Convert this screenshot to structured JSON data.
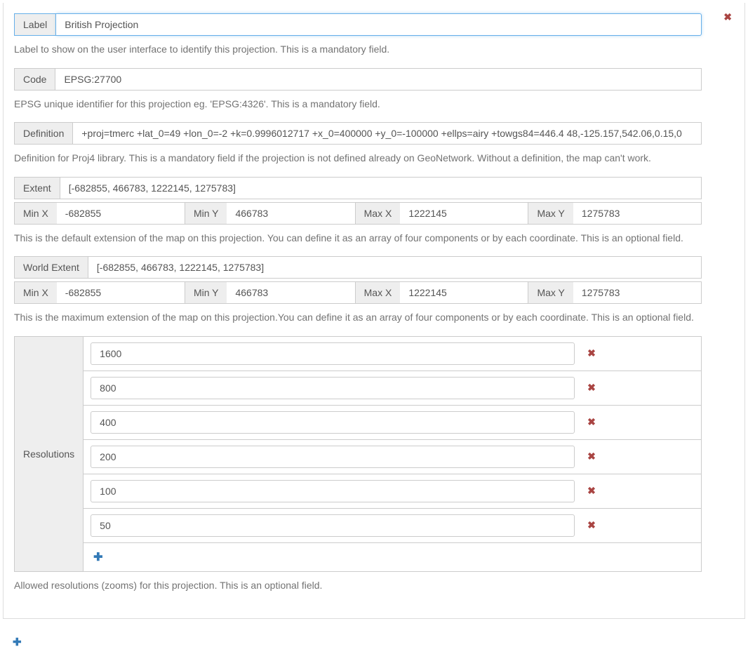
{
  "labels": {
    "label": "Label",
    "code": "Code",
    "definition": "Definition",
    "extent": "Extent",
    "worldExtent": "World Extent",
    "minX": "Min X",
    "minY": "Min Y",
    "maxX": "Max X",
    "maxY": "Max Y",
    "resolutions": "Resolutions"
  },
  "help": {
    "label": "Label to show on the user interface to identify this projection. This is a mandatory field.",
    "code": "EPSG unique identifier for this projection eg. 'EPSG:4326'. This is a mandatory field.",
    "definition": "Definition for Proj4 library. This is a mandatory field if the projection is not defined already on GeoNetwork. Without a definition, the map can't work.",
    "extent": "This is the default extension of the map on this projection. You can define it as an array of four components or by each coordinate. This is an optional field.",
    "worldExtent": "This is the maximum extension of the map on this projection.You can define it as an array of four components or by each coordinate. This is an optional field.",
    "resolutions": "Allowed resolutions (zooms) for this projection. This is an optional field."
  },
  "values": {
    "label": "British Projection",
    "code": "EPSG:27700",
    "definition": "+proj=tmerc +lat_0=49 +lon_0=-2 +k=0.9996012717 +x_0=400000 +y_0=-100000 +ellps=airy +towgs84=446.4 48,-125.157,542.06,0.15,0",
    "extent": {
      "array": "[-682855, 466783, 1222145, 1275783]",
      "minX": "-682855",
      "minY": "466783",
      "maxX": "1222145",
      "maxY": "1275783"
    },
    "worldExtent": {
      "array": "[-682855, 466783, 1222145, 1275783]",
      "minX": "-682855",
      "minY": "466783",
      "maxX": "1222145",
      "maxY": "1275783"
    },
    "resolutions": [
      "1600",
      "800",
      "400",
      "200",
      "100",
      "50"
    ]
  }
}
